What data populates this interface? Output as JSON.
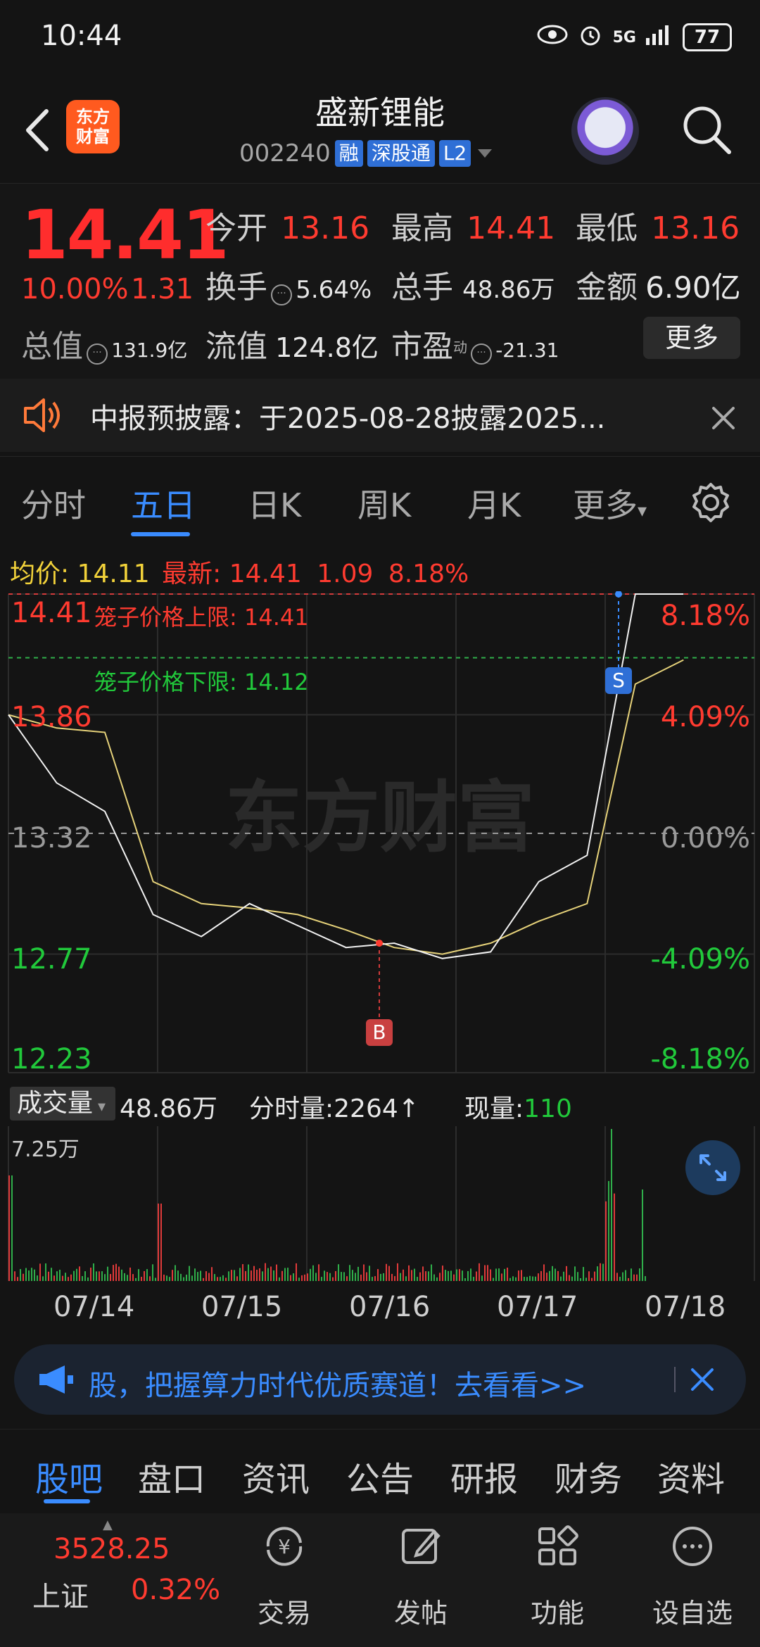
{
  "status_bar": {
    "time": "10:44",
    "network": "5G",
    "battery": "77"
  },
  "header": {
    "title": "盛新锂能",
    "code": "002240",
    "tags": [
      "融",
      "深股通",
      "L2"
    ],
    "logo_text": "东方财富"
  },
  "quote": {
    "price": "14.41",
    "change_pct": "10.00%",
    "change_amt": "1.31",
    "open_label": "今开",
    "open": "13.16",
    "high_label": "最高",
    "high": "14.41",
    "low_label": "最低",
    "low": "13.16",
    "turnover_label": "换手",
    "turnover": "5.64%",
    "volume_label": "总手",
    "volume": "48.86万",
    "amount_label": "金额",
    "amount": "6.90亿",
    "mcap_label": "总值",
    "mcap": "131.9亿",
    "float_label": "流值",
    "float": "124.8亿",
    "pe_label": "市盈",
    "pe_sup": "动",
    "pe": "-21.31",
    "more_label": "更多"
  },
  "notice": {
    "text": "中报预披露：于2025-08-28披露2025..."
  },
  "chart_tabs": [
    "分时",
    "五日",
    "日K",
    "周K",
    "月K",
    "更多"
  ],
  "active_chart_tab": "五日",
  "legend": {
    "avg_label": "均价:",
    "avg": "14.11",
    "latest_label": "最新:",
    "latest": "14.41",
    "change": "1.09",
    "change_pct": "8.18%"
  },
  "chart_data": {
    "type": "line",
    "title": "",
    "x": [
      "07/14",
      "07/15",
      "07/16",
      "07/17",
      "07/18"
    ],
    "series": [
      {
        "name": "price",
        "values": [
          13.86,
          13.55,
          13.42,
          12.95,
          12.85,
          13.0,
          12.9,
          12.8,
          12.82,
          12.75,
          12.78,
          13.1,
          13.22,
          14.41,
          14.41
        ]
      },
      {
        "name": "avg",
        "values": [
          13.86,
          13.8,
          13.78,
          13.1,
          13.0,
          12.98,
          12.95,
          12.88,
          12.8,
          12.77,
          12.82,
          12.92,
          13.0,
          14.0,
          14.11
        ]
      }
    ],
    "y_left_ticks": [
      "14.41",
      "13.86",
      "13.32",
      "12.77",
      "12.23"
    ],
    "y_right_ticks": [
      "8.18%",
      "4.09%",
      "0.00%",
      "-4.09%",
      "-8.18%"
    ],
    "ylim": [
      12.23,
      14.41
    ],
    "upper_limit_label": "笼子价格上限:",
    "upper_limit": "14.41",
    "lower_limit_label": "笼子价格下限:",
    "lower_limit": "14.12",
    "buy_marker": "B",
    "sell_marker": "S",
    "watermark": "东方财富"
  },
  "volume": {
    "selector": "成交量",
    "total": "48.86万",
    "tick_label": "分时量:",
    "tick": "2264",
    "current_label": "现量:",
    "current": "110",
    "max_label": "7.25万"
  },
  "dates": [
    "07/14",
    "07/15",
    "07/16",
    "07/17",
    "07/18"
  ],
  "ad": {
    "text": "股，把握算力时代优质赛道！去看看>>"
  },
  "bottom_tabs": [
    "股吧",
    "盘口",
    "资讯",
    "公告",
    "研报",
    "财务",
    "资料"
  ],
  "nav": {
    "index_value": "3528.25",
    "index_name": "上证",
    "index_pct": "0.32%",
    "items": [
      "交易",
      "发帖",
      "功能",
      "设自选"
    ]
  }
}
